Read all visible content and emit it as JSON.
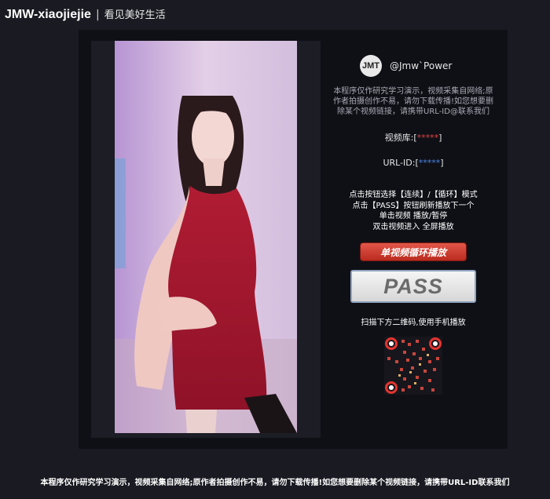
{
  "header": {
    "site_name": "JMW-xiaojiejie",
    "separator": "|",
    "tagline": "看见美好生活"
  },
  "author": {
    "logo_text": "JMT",
    "name": "@Jmw`Power"
  },
  "notice": "本程序仅作研究学习演示，视频采集自网络;原作者拍摄创作不易，请勿下载传播!如您想要删除某个视频链接，请携带URL-ID@联系我们",
  "library": {
    "label": "视频库:",
    "open": "[",
    "value": "*****",
    "close": "]"
  },
  "url_id": {
    "label": "URL-ID:",
    "open": "[",
    "value": "*****",
    "close": "]"
  },
  "help_lines": [
    "点击按钮选择【连续】/【循环】模式",
    "点击【PASS】按钮刷新播放下一个",
    "单击视频 播放/暂停",
    "双击视频进入 全屏播放"
  ],
  "buttons": {
    "loop_label": "单视频循环播放",
    "pass_label": "PASS"
  },
  "scan_text": "扫描下方二维码,使用手机播放",
  "footer": "本程序仅作研究学习演示，视频采集自网络;原作者拍摄创作不易，请勿下载传播!如您想要删除某个视频链接，请携带URL-ID联系我们",
  "colors": {
    "background": "#1a1b22",
    "panel": "#0f1016",
    "mask_red": "#e24343",
    "mask_blue": "#4a86e8",
    "loop_button": "#c8382b",
    "qr_accent": "#e3342f"
  }
}
